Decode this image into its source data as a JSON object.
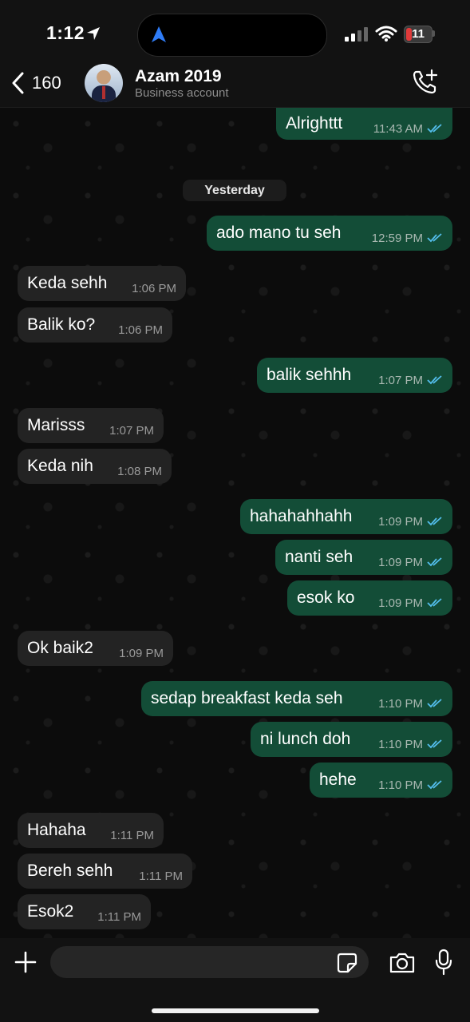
{
  "status": {
    "time": "1:12",
    "battery": "11"
  },
  "header": {
    "back_count": "160",
    "name": "Azam 2019",
    "subtitle": "Business account"
  },
  "date_separator": "Yesterday",
  "messages": [
    {
      "text": "Alrighttt",
      "time": "11:43 AM"
    },
    {
      "text": "ado mano tu seh",
      "time": "12:59 PM"
    },
    {
      "text": "Keda sehh",
      "time": "1:06 PM"
    },
    {
      "text": "Balik ko?",
      "time": "1:06 PM"
    },
    {
      "text": "balik sehhh",
      "time": "1:07 PM"
    },
    {
      "text": "Marisss",
      "time": "1:07 PM"
    },
    {
      "text": "Keda nih",
      "time": "1:08 PM"
    },
    {
      "text": "hahahahhahh",
      "time": "1:09 PM"
    },
    {
      "text": "nanti seh",
      "time": "1:09 PM"
    },
    {
      "text": "esok ko",
      "time": "1:09 PM"
    },
    {
      "text": "Ok baik2",
      "time": "1:09 PM"
    },
    {
      "text": "sedap breakfast keda seh",
      "time": "1:10 PM"
    },
    {
      "text": "ni lunch doh",
      "time": "1:10 PM"
    },
    {
      "text": "hehe",
      "time": "1:10 PM"
    },
    {
      "text": "Hahaha",
      "time": "1:11 PM"
    },
    {
      "text": "Bereh sehh",
      "time": "1:11 PM"
    },
    {
      "text": "Esok2",
      "time": "1:11 PM"
    }
  ],
  "composer": {
    "placeholder": ""
  }
}
